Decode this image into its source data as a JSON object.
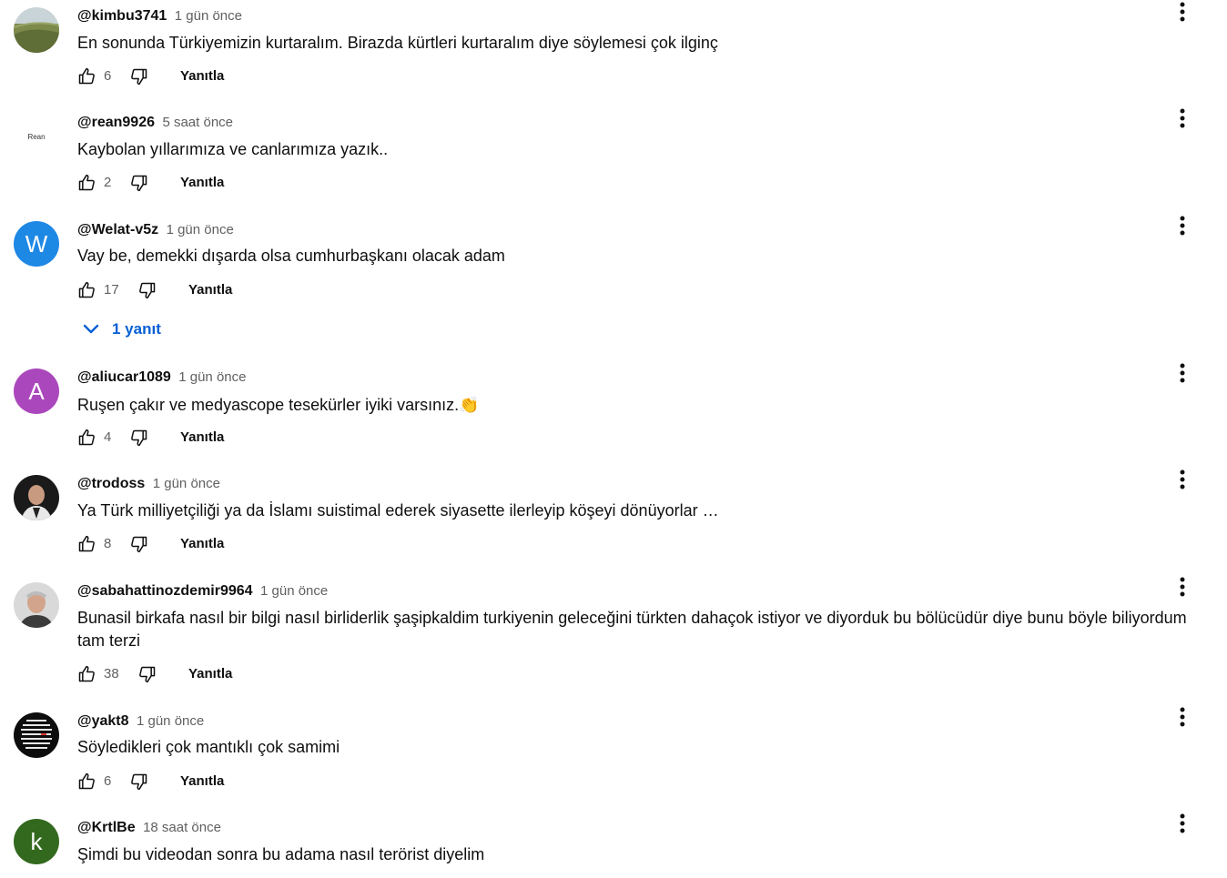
{
  "comments": [
    {
      "author": "@kimbu3741",
      "time": "1 gün önce",
      "text": "En sonunda Türkiyemizin kurtaralım. Birazda kürtleri kurtaralım diye söylemesi çok ilginç",
      "likes": "6",
      "reply": "Yanıtla",
      "avatar": {
        "type": "image",
        "color": "#6b7a4a"
      }
    },
    {
      "author": "@rean9926",
      "time": "5 saat önce",
      "text": "Kaybolan yıllarımıza ve canlarımıza yazık..",
      "likes": "2",
      "reply": "Yanıtla",
      "avatar": {
        "type": "text",
        "label": "Rean",
        "color": "#ffffff"
      }
    },
    {
      "author": "@Welat-v5z",
      "time": "1 gün önce",
      "text": "Vay be, demekki dışarda olsa cumhurbaşkanı olacak adam",
      "likes": "17",
      "reply": "Yanıtla",
      "avatar": {
        "type": "letter",
        "label": "W",
        "color": "#1e88e5"
      },
      "replies": "1 yanıt"
    },
    {
      "author": "@aliucar1089",
      "time": "1 gün önce",
      "text": "Ruşen çakır ve medyascope tesekürler iyiki varsınız.👏",
      "likes": "4",
      "reply": "Yanıtla",
      "avatar": {
        "type": "letter",
        "label": "A",
        "color": "#ab47bc"
      }
    },
    {
      "author": "@trodoss",
      "time": "1 gün önce",
      "text": "Ya Türk milliyetçiliği ya da İslamı suistimal ederek siyasette ilerleyip köşeyi dönüyorlar …",
      "likes": "8",
      "reply": "Yanıtla",
      "avatar": {
        "type": "image",
        "color": "#2a2a2a"
      }
    },
    {
      "author": "@sabahattinozdemir9964",
      "time": "1 gün önce",
      "text": "Bunasil birkafa nasıl bir bilgi nasıl birliderlik şaşipkaldim turkiyenin geleceğini türkten dahaçok istiyor ve diyorduk bu bölücüdür diye bunu böyle biliyordum tam terzi",
      "likes": "38",
      "reply": "Yanıtla",
      "avatar": {
        "type": "image",
        "color": "#b7b7b7"
      }
    },
    {
      "author": "@yakt8",
      "time": "1 gün önce",
      "text": "Söyledikleri çok mantıklı çok samimi",
      "likes": "6",
      "reply": "Yanıtla",
      "avatar": {
        "type": "image",
        "color": "#111111"
      }
    },
    {
      "author": "@KrtlBe",
      "time": "18 saat önce",
      "text": "Şimdi bu videodan sonra bu adama nasıl terörist diyelim",
      "likes": "",
      "reply": "",
      "avatar": {
        "type": "letter",
        "label": "k",
        "color": "#33691e"
      }
    }
  ],
  "colors": {
    "link": "#065fd4",
    "secondary_text": "#606060",
    "primary_text": "#0f0f0f"
  },
  "icons": {
    "like": "thumb-up-icon",
    "dislike": "thumb-down-icon",
    "menu": "more-vert-icon",
    "expand": "chevron-down-icon"
  }
}
